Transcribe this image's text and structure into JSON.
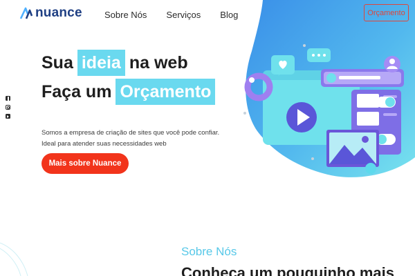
{
  "brand": {
    "name": "nuance",
    "accent": "#1f3f83",
    "mark_color": "#4fb0ff"
  },
  "nav": {
    "items": [
      {
        "label": "Sobre Nós"
      },
      {
        "label": "Serviços"
      },
      {
        "label": "Blog"
      }
    ]
  },
  "header": {
    "quote_button": "Orçamento"
  },
  "social": {
    "icons": [
      "facebook-icon",
      "instagram-icon",
      "youtube-icon"
    ]
  },
  "hero": {
    "line1": {
      "before": "Sua",
      "highlight": "ideia",
      "after": "na web"
    },
    "line2": {
      "before": "Faça um",
      "highlight": "Orçamento"
    },
    "description_line1": "Somos a empresa de criação de sites que você pode confiar.",
    "description_line2": "Ideal para atender suas necessidades web",
    "cta": "Mais sobre Nuance"
  },
  "about": {
    "eyebrow": "Sobre Nós",
    "title": "Conheça um pouquinho mais"
  },
  "colors": {
    "highlight": "#6ad9ef",
    "cta": "#f2341b",
    "quote_border": "#e0453a",
    "blob_start": "#6fe0ef",
    "blob_end": "#3a8fe8"
  }
}
